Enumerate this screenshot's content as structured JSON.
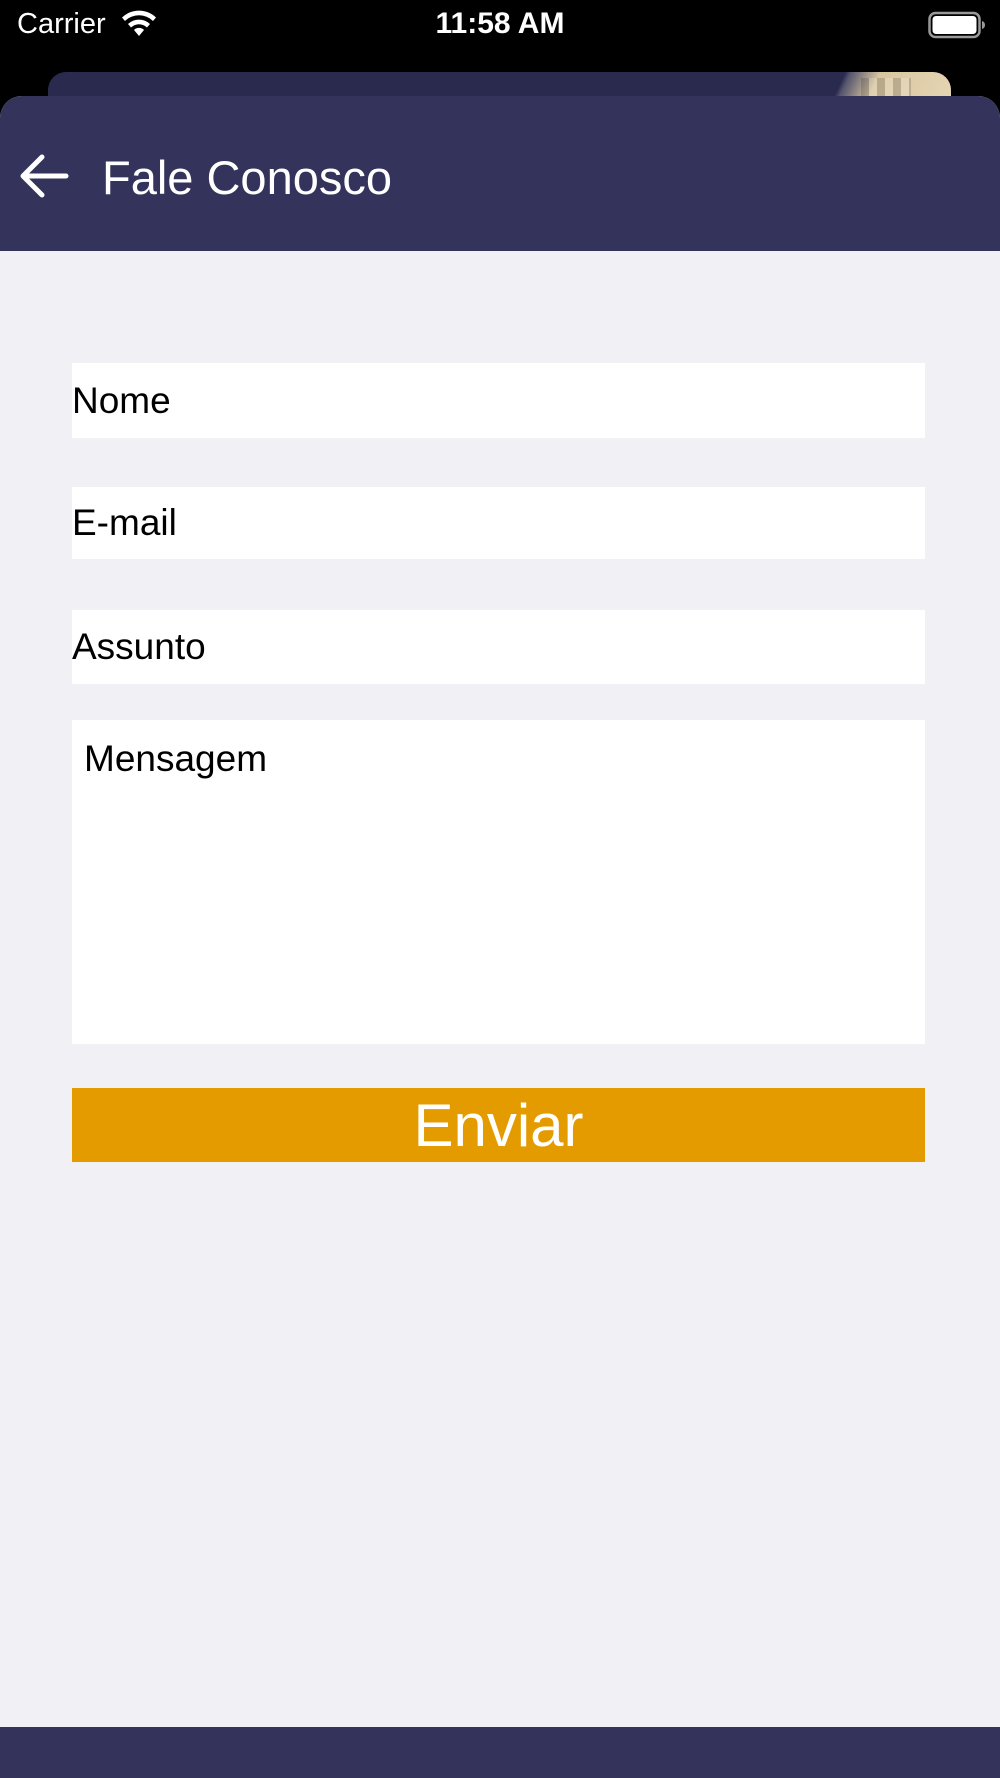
{
  "status_bar": {
    "carrier": "Carrier",
    "time": "11:58 AM",
    "wifi_icon": "wifi-icon",
    "battery_icon": "battery-full-icon"
  },
  "nav": {
    "title": "Fale Conosco",
    "back_icon": "arrow-left-icon"
  },
  "form": {
    "nome_placeholder": "Nome",
    "email_placeholder": "E-mail",
    "assunto_placeholder": "Assunto",
    "mensagem_placeholder": "Mensagem",
    "submit_label": "Enviar"
  },
  "colors": {
    "nav_background": "#33335b",
    "page_background": "#f1f0f5",
    "submit_background": "#e39b00",
    "submit_text": "#ffffff"
  }
}
